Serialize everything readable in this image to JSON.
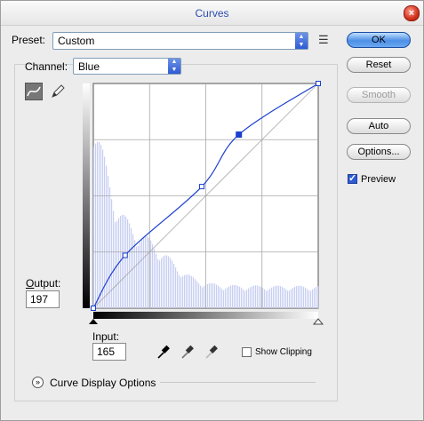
{
  "window": {
    "title": "Curves"
  },
  "preset": {
    "label": "Preset:",
    "value": "Custom"
  },
  "channel": {
    "label": "Channel:",
    "value": "Blue"
  },
  "buttons": {
    "ok": "OK",
    "reset": "Reset",
    "smooth": "Smooth",
    "auto": "Auto",
    "options": "Options..."
  },
  "preview": {
    "label": "Preview",
    "checked": true
  },
  "output": {
    "label": "Output:",
    "value": "197"
  },
  "input": {
    "label": "Input:",
    "value": "165"
  },
  "show_clipping": {
    "label": "Show Clipping",
    "checked": false
  },
  "curve_display_options": {
    "label": "Curve Display Options"
  },
  "curve": {
    "color": "#1a3fd0",
    "points": [
      [
        0,
        0
      ],
      [
        36,
        60
      ],
      [
        123,
        138
      ],
      [
        165,
        197
      ],
      [
        255,
        255
      ]
    ],
    "selected_point": [
      165,
      197
    ]
  },
  "histogram_color": "#c9cff2",
  "icons": {
    "close": "close-icon",
    "menu": "panel-menu-icon",
    "curve_tool": "curve-tool-icon",
    "pencil_tool": "pencil-tool-icon",
    "black_eyedropper": "black-point-eyedropper-icon",
    "gray_eyedropper": "gray-point-eyedropper-icon",
    "white_eyedropper": "white-point-eyedropper-icon",
    "disclosure": "expand-chevron-icon"
  }
}
